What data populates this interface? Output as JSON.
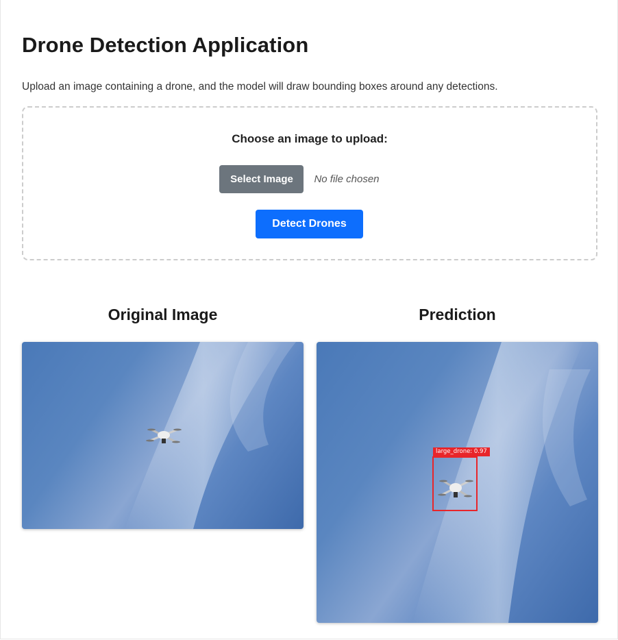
{
  "page": {
    "title": "Drone Detection Application",
    "intro": "Upload an image containing a drone, and the model will draw bounding boxes around any detections."
  },
  "upload": {
    "label": "Choose an image to upload:",
    "select_button": "Select Image",
    "file_status": "No file chosen",
    "detect_button": "Detect Drones"
  },
  "panels": {
    "original_title": "Original Image",
    "prediction_title": "Prediction"
  },
  "detection": {
    "label": "large_drone: 0.97",
    "box_color": "#e8252a"
  },
  "colors": {
    "select_button": "#6c757d",
    "detect_button": "#0d6efd",
    "sky": "#4a79b8"
  }
}
